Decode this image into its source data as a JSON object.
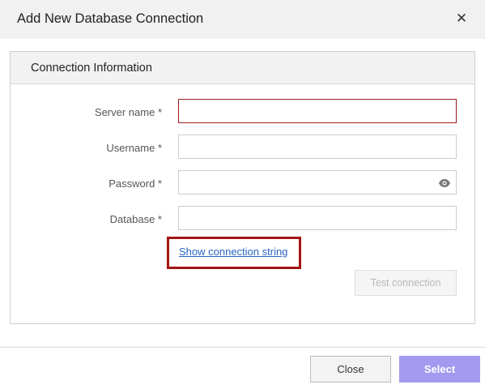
{
  "dialog": {
    "title": "Add New Database Connection",
    "close_icon": "close-x-icon"
  },
  "panel": {
    "title": "Connection Information"
  },
  "fields": {
    "server_name": {
      "label": "Server name *",
      "value": ""
    },
    "username": {
      "label": "Username *",
      "value": ""
    },
    "password": {
      "label": "Password *",
      "value": "",
      "icon": "eye-icon"
    },
    "database": {
      "label": "Database *",
      "value": ""
    }
  },
  "links": {
    "show_connection_string": "Show connection string"
  },
  "buttons": {
    "test_connection": "Test connection",
    "close": "Close",
    "select": "Select"
  },
  "colors": {
    "accent": "#a39af0",
    "error_border": "#9b1b1b",
    "highlight": "#a31515",
    "link": "#2a65c4"
  }
}
